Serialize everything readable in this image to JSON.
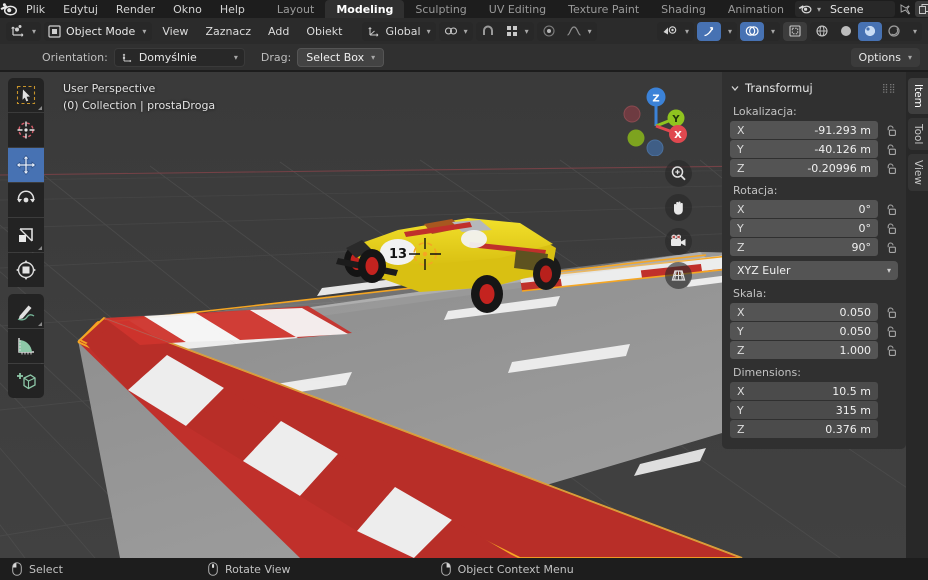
{
  "topbar": {
    "logo_icon": "blender-logo-icon",
    "menus": [
      "Plik",
      "Edytuj",
      "Render",
      "Okno",
      "Help"
    ],
    "workspace_tabs": [
      {
        "label": "Layout",
        "active": false
      },
      {
        "label": "Modeling",
        "active": true
      },
      {
        "label": "Sculpting",
        "active": false
      },
      {
        "label": "UV Editing",
        "active": false
      },
      {
        "label": "Texture Paint",
        "active": false
      },
      {
        "label": "Shading",
        "active": false
      },
      {
        "label": "Animation",
        "active": false
      }
    ],
    "scene": {
      "icon": "scene-icon",
      "name": "Scene",
      "pin_icon": "pin-icon",
      "new_icon": "duplicate-icon",
      "close_icon": "close-icon",
      "viewlayer_icon": "view-layer-icon"
    }
  },
  "viewport_header": {
    "editor_type_icon": "editor-type-3dview-icon",
    "mode": "Object Mode",
    "mode_icon": "object-mode-icon",
    "menus": [
      "View",
      "Zaznacz",
      "Add",
      "Obiekt"
    ],
    "transform_orientation": {
      "icon": "orientation-global-icon",
      "value": "Global"
    },
    "snap_icon": "snap-magnet-icon",
    "snap_target_icon": "snap-increment-icon",
    "proportional_icon": "proportional-edit-icon",
    "falloff_icon": "smooth-falloff-icon",
    "visibility_icon": "visibility-eye-icon",
    "gizmo_icon": "gizmo-icon",
    "overlays_icon": "overlays-icon",
    "xray_icon": "xray-toggle-icon",
    "shading_modes": [
      {
        "icon": "shading-wireframe-icon",
        "active": false
      },
      {
        "icon": "shading-solid-icon",
        "active": false
      },
      {
        "icon": "shading-material-icon",
        "active": true
      },
      {
        "icon": "shading-rendered-icon",
        "active": false
      }
    ]
  },
  "tool_settings": {
    "orientation_label": "Orientation:",
    "orientation_icon": "orientation-default-icon",
    "orientation_value": "Domyślnie",
    "drag_label": "Drag:",
    "drag_value": "Select Box",
    "options_label": "Options"
  },
  "viewport": {
    "perspective_label": "User Perspective",
    "collection_label": "(0) Collection | prostaDroga",
    "toolbar": [
      {
        "name": "tweak-select-tool",
        "icon": "cursor-arrow-icon",
        "active": false
      },
      {
        "name": "cursor-tool",
        "icon": "3d-cursor-icon",
        "active": false
      },
      {
        "name": "move-tool",
        "icon": "move-arrows-icon",
        "active": true
      },
      {
        "name": "rotate-tool",
        "icon": "rotate-icon",
        "active": false
      },
      {
        "name": "scale-tool",
        "icon": "scale-icon",
        "active": false
      },
      {
        "name": "transform-tool",
        "icon": "transform-icon",
        "active": false
      },
      {
        "name": "annotate-tool",
        "icon": "pencil-icon",
        "active": false
      },
      {
        "name": "measure-tool",
        "icon": "ruler-icon",
        "active": false
      },
      {
        "name": "add-cube-tool",
        "icon": "add-cube-icon",
        "active": false
      }
    ],
    "gizmo_axes": [
      {
        "label": "Z",
        "color": "#3b82d8"
      },
      {
        "label": "Y",
        "color": "#8fc31f"
      },
      {
        "label": "X",
        "color": "#e0484f"
      }
    ],
    "nav_buttons": [
      {
        "name": "zoom-view-button",
        "icon": "magnifier-plus-icon"
      },
      {
        "name": "pan-view-button",
        "icon": "hand-icon"
      },
      {
        "name": "camera-view-button",
        "icon": "camera-icon"
      },
      {
        "name": "toggle-perspective-button",
        "icon": "perspective-grid-icon"
      }
    ]
  },
  "sidebar": {
    "tabs": [
      {
        "label": "Item",
        "active": true
      },
      {
        "label": "Tool",
        "active": false
      },
      {
        "label": "View",
        "active": false
      }
    ],
    "panel_title": "Transformuj",
    "collapse_icon": "chevron-down-icon",
    "grip_icon": "grip-dots-icon",
    "lock_icon": "unlocked-padlock-icon",
    "sections": [
      {
        "label": "Lokalizacja:",
        "fields": [
          {
            "axis": "X",
            "value": "-91.293 m"
          },
          {
            "axis": "Y",
            "value": "-40.126 m"
          },
          {
            "axis": "Z",
            "value": "-0.20996 m"
          }
        ],
        "locks": true
      },
      {
        "label": "Rotacja:",
        "fields": [
          {
            "axis": "X",
            "value": "0°"
          },
          {
            "axis": "Y",
            "value": "0°"
          },
          {
            "axis": "Z",
            "value": "90°"
          }
        ],
        "locks": true
      }
    ],
    "rotation_mode": "XYZ Euler",
    "scale": {
      "label": "Skala:",
      "fields": [
        {
          "axis": "X",
          "value": "0.050"
        },
        {
          "axis": "Y",
          "value": "0.050"
        },
        {
          "axis": "Z",
          "value": "1.000"
        }
      ]
    },
    "dimensions": {
      "label": "Dimensions:",
      "fields": [
        {
          "axis": "X",
          "value": "10.5 m"
        },
        {
          "axis": "Y",
          "value": "315 m"
        },
        {
          "axis": "Z",
          "value": "0.376 m"
        }
      ]
    }
  },
  "statusbar": {
    "items": [
      {
        "icon": "mouse-left-button-icon",
        "label": "Select"
      },
      {
        "icon": "mouse-middle-button-icon",
        "label": "Rotate View"
      },
      {
        "icon": "mouse-right-button-icon",
        "label": "Object Context Menu"
      }
    ]
  },
  "colors": {
    "accent_blue": "#4772b3",
    "select_orange": "#f5a623",
    "bg_dark": "#1d1d1d",
    "bg_header": "#2b2b2b",
    "bg_panel": "#303030",
    "field": "#545454",
    "car_yellow": "#e8d520",
    "kerb_red": "#c0302b",
    "kerb_white": "#eceded",
    "road_gray": "#8c8c8c",
    "ground_dark": "#3b3b3b"
  }
}
